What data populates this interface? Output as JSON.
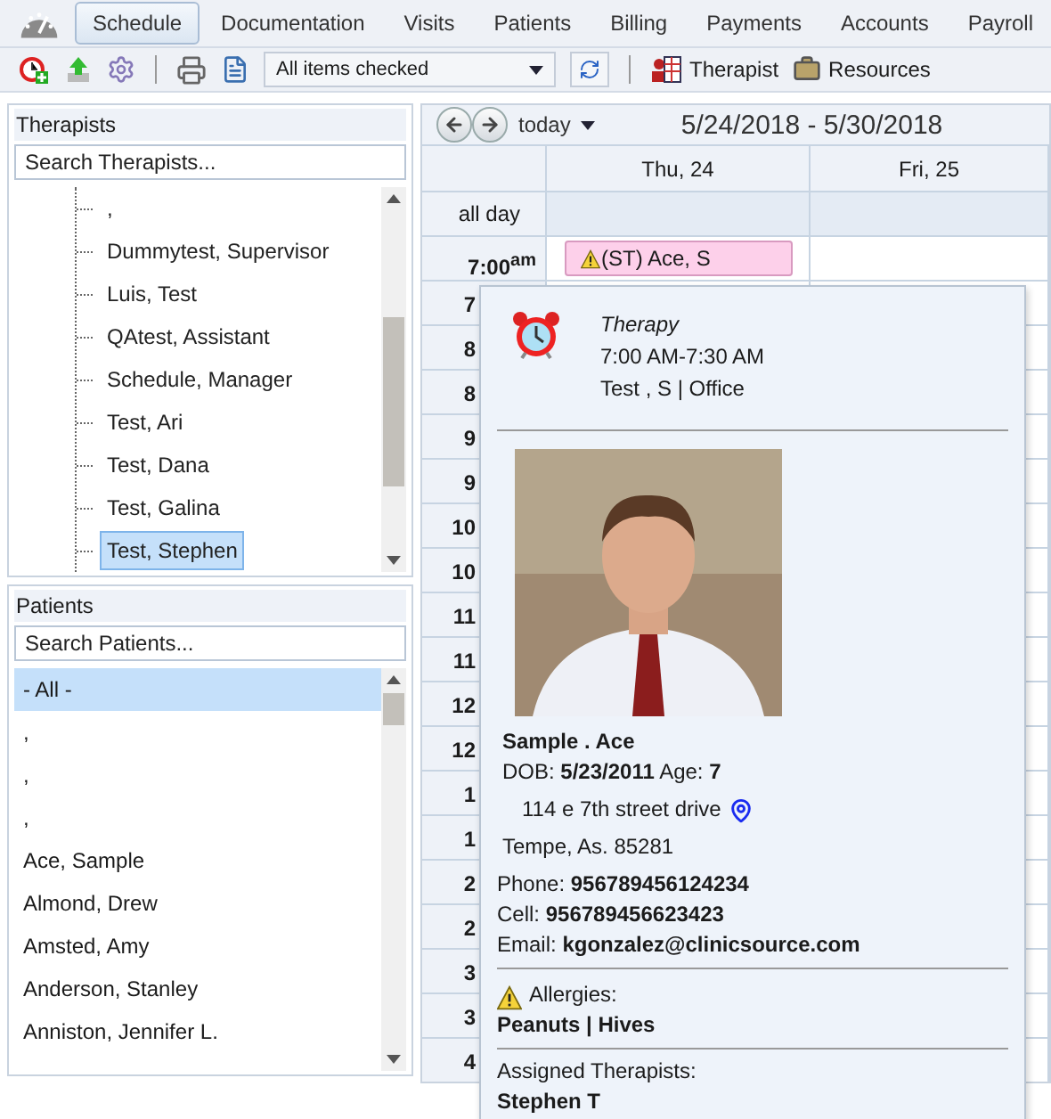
{
  "nav": {
    "tabs": [
      {
        "label": "Schedule",
        "selected": true
      },
      {
        "label": "Documentation",
        "selected": false
      },
      {
        "label": "Visits",
        "selected": false
      },
      {
        "label": "Patients",
        "selected": false
      },
      {
        "label": "Billing",
        "selected": false
      },
      {
        "label": "Payments",
        "selected": false
      },
      {
        "label": "Accounts",
        "selected": false
      },
      {
        "label": "Payroll",
        "selected": false
      }
    ]
  },
  "toolbar": {
    "filter": "All items checked",
    "buttons": [
      {
        "label": "Therapist",
        "kind": "therapist"
      },
      {
        "label": "Resources",
        "kind": "resources"
      }
    ]
  },
  "therapists": {
    "title": "Therapists",
    "placeholder": "Search Therapists...",
    "items": [
      {
        "name": ",",
        "selected": false
      },
      {
        "name": "Dummytest, Supervisor",
        "selected": false
      },
      {
        "name": "Luis, Test",
        "selected": false
      },
      {
        "name": "QAtest, Assistant",
        "selected": false
      },
      {
        "name": "Schedule, Manager",
        "selected": false
      },
      {
        "name": "Test, Ari",
        "selected": false
      },
      {
        "name": "Test, Dana",
        "selected": false
      },
      {
        "name": "Test, Galina",
        "selected": false
      },
      {
        "name": "Test, Stephen",
        "selected": true
      }
    ]
  },
  "patients": {
    "title": "Patients",
    "placeholder": "Search Patients...",
    "items": [
      {
        "name": "- All -",
        "selected": true
      },
      {
        "name": ",",
        "selected": false
      },
      {
        "name": ",",
        "selected": false
      },
      {
        "name": ",",
        "selected": false
      },
      {
        "name": "Ace, Sample",
        "selected": false
      },
      {
        "name": "Almond, Drew",
        "selected": false
      },
      {
        "name": "Amsted, Amy",
        "selected": false
      },
      {
        "name": "Anderson, Stanley",
        "selected": false
      },
      {
        "name": "Anniston, Jennifer L.",
        "selected": false
      }
    ]
  },
  "calendar": {
    "today": "today",
    "range": "5/24/2018 - 5/30/2018",
    "days": [
      "Thu, 24",
      "Fri, 25"
    ],
    "all_day": "all day",
    "times": [
      "7:00$^{am}$",
      "7",
      "8",
      "8",
      "9",
      "9",
      "10",
      "10",
      "11",
      "11",
      "12",
      "12",
      "1",
      "1",
      "2",
      "2",
      "3",
      "3",
      "4"
    ],
    "event": {
      "text": "(ST) Ace, S"
    },
    "popup": {
      "type": "Therapy",
      "time": "7:00 AM-7:30 AM",
      "who": "Test , S | Office",
      "patient": "Sample . Ace",
      "dob_line": "DOB: **5/23/2011** Age: **7**",
      "address": "114 e 7th street drive",
      "city": "Tempe, As. 85281",
      "contacts": [
        "Phone: **956789456124234**",
        "Cell: **956789456623423**",
        "Email: **kgonzalez@clinicsource.com**"
      ],
      "allergies_label": "Allergies:",
      "allergies": "Peanuts | Hives",
      "assigned_label": "Assigned Therapists:",
      "assigned": "Stephen T"
    }
  }
}
